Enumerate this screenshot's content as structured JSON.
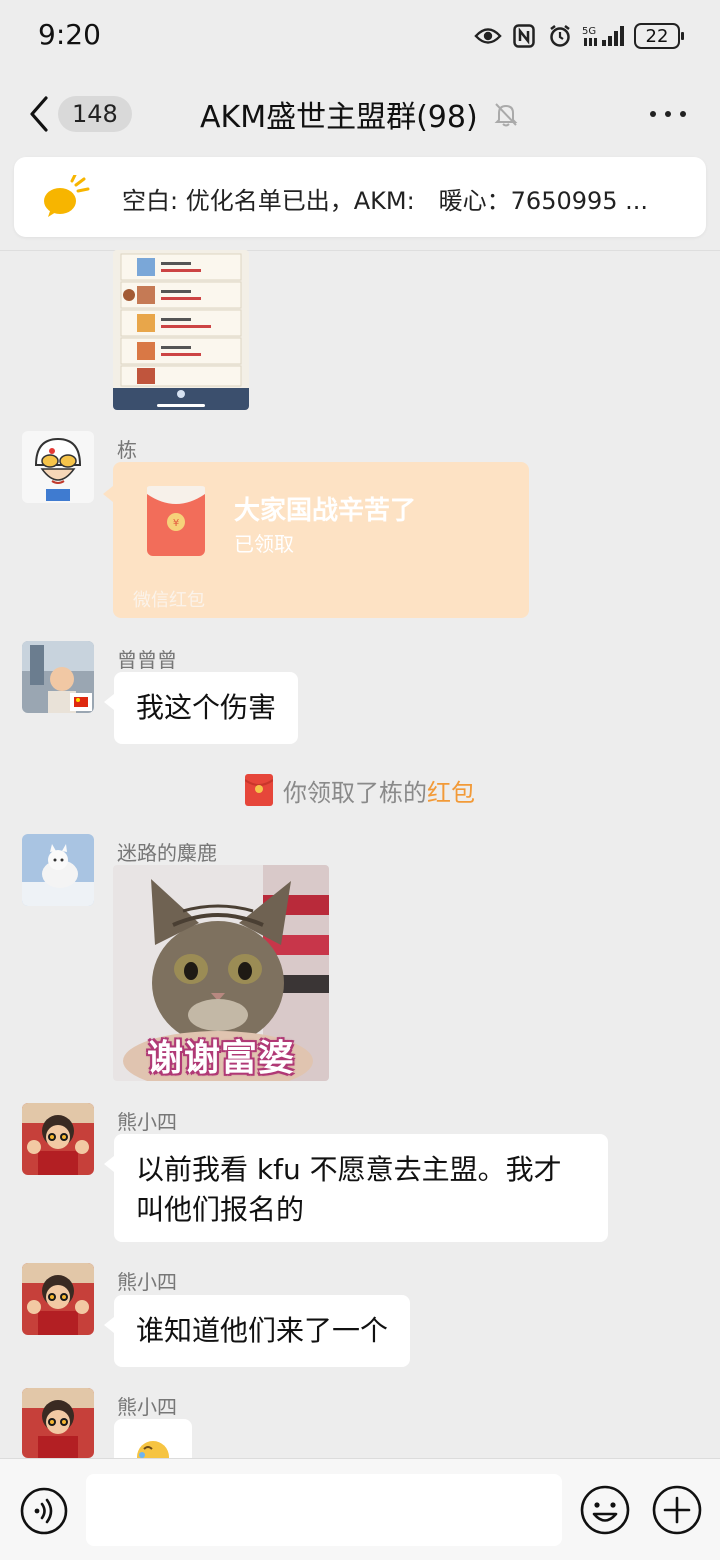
{
  "status_bar": {
    "time": "9:20",
    "battery": "22",
    "network": "5G"
  },
  "nav": {
    "unread_count": "148",
    "title": "AKM盛世主盟群(98)"
  },
  "notice": {
    "text": "空白: 优化名单已出，AKM:　暖心：7650995 ..."
  },
  "messages": {
    "m1": {
      "sender": "栋",
      "red_packet": {
        "title": "大家国战辛苦了",
        "status": "已领取",
        "footer": "微信红包"
      }
    },
    "m2": {
      "sender": "曾曾曾",
      "text": "我这个伤害"
    },
    "system": {
      "prefix": "你领取了栋的",
      "link": "红包"
    },
    "m3": {
      "sender": "迷路的麋鹿",
      "sticker_caption": "谢谢富婆"
    },
    "m4": {
      "sender": "熊小四",
      "line1": "以前我看 kfu 不愿意去主盟。我才",
      "line2": "叫他们报名的"
    },
    "m5": {
      "sender": "熊小四",
      "text": "谁知道他们来了一个"
    },
    "m6": {
      "sender": "熊小四"
    }
  },
  "icons": {
    "back": "chevron-left-icon",
    "mute": "bell-off-icon",
    "more": "more-icon",
    "notice": "megaphone-icon",
    "voice": "voice-icon",
    "emoji": "emoji-icon",
    "plus": "plus-icon"
  },
  "colors": {
    "background": "#ededed",
    "bubble": "#ffffff",
    "red_packet": "#fde2c4",
    "link": "#f29a38",
    "notice_icon": "#f7b500"
  }
}
